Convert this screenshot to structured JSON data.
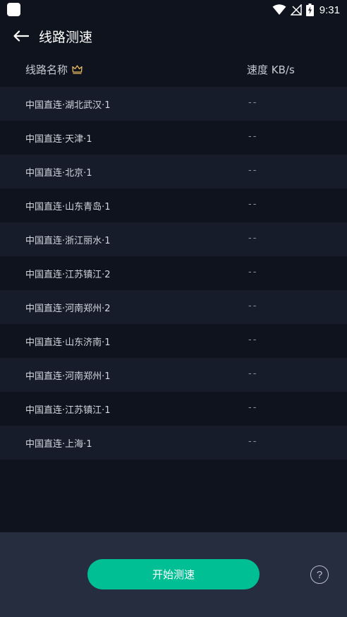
{
  "status_bar": {
    "time": "9:31",
    "icons": [
      "wifi-icon",
      "signal-icon",
      "battery-charging-icon"
    ]
  },
  "header": {
    "back_icon": "arrow-left-icon",
    "title": "线路测速"
  },
  "table": {
    "columns": {
      "name": "线路名称",
      "name_icon": "crown-icon",
      "speed": "速度 KB/s"
    },
    "rows": [
      {
        "name": "中国直连·湖北武汉·1",
        "speed": "--"
      },
      {
        "name": "中国直连·天津·1",
        "speed": "--"
      },
      {
        "name": "中国直连·北京·1",
        "speed": "--"
      },
      {
        "name": "中国直连·山东青岛·1",
        "speed": "--"
      },
      {
        "name": "中国直连·浙江丽水·1",
        "speed": "--"
      },
      {
        "name": "中国直连·江苏镇江·2",
        "speed": "--"
      },
      {
        "name": "中国直连·河南郑州·2",
        "speed": "--"
      },
      {
        "name": "中国直连·山东济南·1",
        "speed": "--"
      },
      {
        "name": "中国直连·河南郑州·1",
        "speed": "--"
      },
      {
        "name": "中国直连·江苏镇江·1",
        "speed": "--"
      },
      {
        "name": "中国直连·上海·1",
        "speed": "--"
      }
    ]
  },
  "footer": {
    "start_button": "开始测速",
    "help": "?"
  },
  "colors": {
    "background": "#0f131d",
    "row_alt": "#171c2b",
    "bottom_bar": "#262d3e",
    "accent": "#00bf94",
    "crown": "#e6b85c"
  }
}
